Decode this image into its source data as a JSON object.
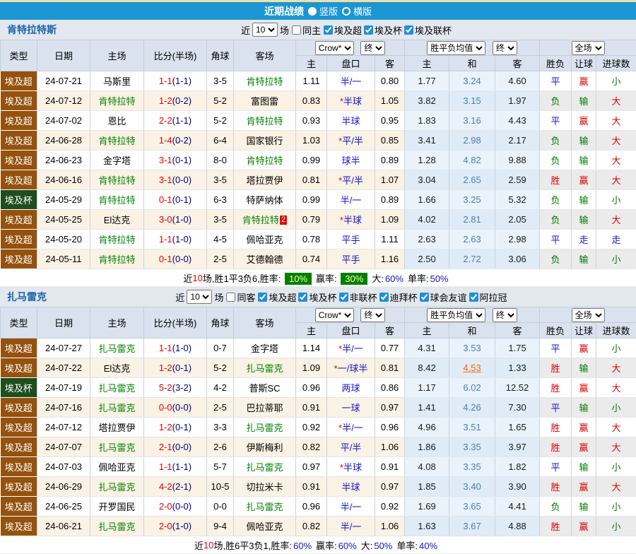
{
  "topbar": {
    "title": "近期战绩",
    "radio_vertical": "竖版",
    "radio_horizontal": "横版"
  },
  "colors": {
    "topbar_bg": "#1B96D2",
    "league_type_bg": "#94520E",
    "cup_type_bg": "#1E4D1E",
    "focus_team": "#008000",
    "win_red": "#DD0000",
    "draw_blue": "#1414CC",
    "loss_green": "#007A00",
    "badge_green_bg": "#008000",
    "link_orange": "#FF6600",
    "fulltime_score": "#E60000",
    "halftime_score": "#000080"
  },
  "filters_common": {
    "near": "近",
    "count": "10",
    "games": "场"
  },
  "dropdowns": {
    "company": "Crow*",
    "final": "终",
    "avg": "胜平负均值",
    "scope": "全场"
  },
  "columns": {
    "type": "类型",
    "date": "日期",
    "home": "主场",
    "score": "比分(半场)",
    "corner": "角球",
    "away": "客场",
    "odds_home": "主",
    "handicap": "盘口",
    "odds_away": "客",
    "avg_home": "主",
    "avg_draw": "和",
    "avg_away": "客",
    "result_wdl": "胜负",
    "result_handicap": "让球",
    "result_goals": "进球数"
  },
  "sections": [
    {
      "team": "肯特拉特斯",
      "filters": {
        "same_label": "同主",
        "same_checked": false,
        "leagues": [
          {
            "label": "埃及超",
            "checked": true
          },
          {
            "label": "埃及杯",
            "checked": true
          },
          {
            "label": "埃及联杯",
            "checked": true
          }
        ]
      },
      "rows": [
        {
          "type": "埃及超",
          "cup": false,
          "date": "24-07-21",
          "home": "马斯里",
          "home_focus": false,
          "score": "1-1",
          "half": "(1-1)",
          "corner": "3-5",
          "away": "肯特拉特",
          "away_focus": true,
          "away_badge": "",
          "o1": "1.11",
          "star": "",
          "hcp": "半/一",
          "o2": "0.80",
          "a1": "1.77",
          "a2": "3.24",
          "a2_link": false,
          "a3": "4.60",
          "r1": "平",
          "r1c": "blue",
          "r2": "赢",
          "r2c": "red",
          "r3": "小",
          "r3c": "green"
        },
        {
          "type": "埃及超",
          "cup": false,
          "date": "24-07-12",
          "home": "肯特拉特",
          "home_focus": true,
          "score": "1-2",
          "half": "(0-2)",
          "corner": "5-2",
          "away": "富图雷",
          "away_focus": false,
          "away_badge": "",
          "o1": "0.83",
          "star": "*",
          "hcp": "半球",
          "o2": "1.05",
          "a1": "3.82",
          "a2": "3.15",
          "a2_link": false,
          "a3": "1.97",
          "r1": "负",
          "r1c": "green",
          "r2": "输",
          "r2c": "green",
          "r3": "大",
          "r3c": "red"
        },
        {
          "type": "埃及超",
          "cup": false,
          "date": "24-07-02",
          "home": "恩比",
          "home_focus": false,
          "score": "2-2",
          "half": "(1-1)",
          "corner": "5-2",
          "away": "肯特拉特",
          "away_focus": true,
          "away_badge": "",
          "o1": "0.93",
          "star": "",
          "hcp": "半球",
          "o2": "0.95",
          "a1": "1.83",
          "a2": "3.16",
          "a2_link": false,
          "a3": "4.43",
          "r1": "平",
          "r1c": "blue",
          "r2": "赢",
          "r2c": "red",
          "r3": "大",
          "r3c": "red"
        },
        {
          "type": "埃及超",
          "cup": false,
          "date": "24-06-28",
          "home": "肯特拉特",
          "home_focus": true,
          "score": "1-4",
          "half": "(0-2)",
          "corner": "6-4",
          "away": "国家银行",
          "away_focus": false,
          "away_badge": "",
          "o1": "1.03",
          "star": "*",
          "hcp": "平/半",
          "o2": "0.85",
          "a1": "3.41",
          "a2": "2.98",
          "a2_link": false,
          "a3": "2.17",
          "r1": "负",
          "r1c": "green",
          "r2": "输",
          "r2c": "green",
          "r3": "大",
          "r3c": "red"
        },
        {
          "type": "埃及超",
          "cup": false,
          "date": "24-06-23",
          "home": "金字塔",
          "home_focus": false,
          "score": "3-1",
          "half": "(0-1)",
          "corner": "8-0",
          "away": "肯特拉特",
          "away_focus": true,
          "away_badge": "",
          "o1": "0.99",
          "star": "",
          "hcp": "球半",
          "o2": "0.89",
          "a1": "1.28",
          "a2": "4.82",
          "a2_link": false,
          "a3": "9.88",
          "r1": "负",
          "r1c": "green",
          "r2": "输",
          "r2c": "green",
          "r3": "大",
          "r3c": "red"
        },
        {
          "type": "埃及超",
          "cup": false,
          "date": "24-06-16",
          "home": "肯特拉特",
          "home_focus": true,
          "score": "3-1",
          "half": "(0-0)",
          "corner": "3-5",
          "away": "塔拉贾伊",
          "away_focus": false,
          "away_badge": "",
          "o1": "0.81",
          "star": "*",
          "hcp": "平/半",
          "o2": "1.07",
          "a1": "3.04",
          "a2": "2.65",
          "a2_link": false,
          "a3": "2.59",
          "r1": "胜",
          "r1c": "red",
          "r2": "赢",
          "r2c": "red",
          "r3": "大",
          "r3c": "red"
        },
        {
          "type": "埃及杯",
          "cup": true,
          "date": "24-05-29",
          "home": "肯特拉特",
          "home_focus": true,
          "score": "0-1",
          "half": "(0-1)",
          "corner": "6-3",
          "away": "特萨纳体",
          "away_focus": false,
          "away_badge": "",
          "o1": "0.99",
          "star": "",
          "hcp": "半/一",
          "o2": "0.89",
          "a1": "1.66",
          "a2": "3.25",
          "a2_link": false,
          "a3": "5.32",
          "r1": "负",
          "r1c": "green",
          "r2": "输",
          "r2c": "green",
          "r3": "小",
          "r3c": "green"
        },
        {
          "type": "埃及超",
          "cup": false,
          "date": "24-05-25",
          "home": "El达克",
          "home_focus": false,
          "score": "3-0",
          "half": "(1-0)",
          "corner": "3-5",
          "away": "肯特拉特",
          "away_focus": true,
          "away_badge": "2",
          "o1": "0.79",
          "star": "*",
          "hcp": "半球",
          "o2": "1.09",
          "a1": "4.02",
          "a2": "2.81",
          "a2_link": false,
          "a3": "2.05",
          "r1": "负",
          "r1c": "green",
          "r2": "输",
          "r2c": "green",
          "r3": "大",
          "r3c": "red"
        },
        {
          "type": "埃及超",
          "cup": false,
          "date": "24-05-20",
          "home": "肯特拉特",
          "home_focus": true,
          "score": "1-1",
          "half": "(1-0)",
          "corner": "4-5",
          "away": "佩哈亚克",
          "away_focus": false,
          "away_badge": "",
          "o1": "0.78",
          "star": "",
          "hcp": "平手",
          "o2": "1.11",
          "a1": "2.63",
          "a2": "2.63",
          "a2_link": false,
          "a3": "2.98",
          "r1": "平",
          "r1c": "blue",
          "r2": "走",
          "r2c": "blue",
          "r3": "走",
          "r3c": "blue"
        },
        {
          "type": "埃及超",
          "cup": false,
          "date": "24-05-11",
          "home": "肯特拉特",
          "home_focus": true,
          "score": "0-1",
          "half": "(0-0)",
          "corner": "2-5",
          "away": "艾德翰德",
          "away_focus": false,
          "away_badge": "",
          "o1": "0.74",
          "star": "",
          "hcp": "平手",
          "o2": "1.16",
          "a1": "2.50",
          "a2": "2.72",
          "a2_link": false,
          "a3": "3.06",
          "r1": "负",
          "r1c": "green",
          "r2": "输",
          "r2c": "green",
          "r3": "小",
          "r3c": "green"
        }
      ],
      "summary": {
        "count": "10",
        "record": "场,胜1平3负6, ",
        "items": [
          {
            "label": "胜率: ",
            "value": "10%",
            "badge": true
          },
          {
            "label": "赢率: ",
            "value": "30%",
            "badge": true
          },
          {
            "label": "大:",
            "value": "60%",
            "badge": false
          },
          {
            "label": "单率:",
            "value": "50%",
            "badge": false
          }
        ]
      }
    },
    {
      "team": "扎马雷克",
      "filters": {
        "same_label": "同客",
        "same_checked": false,
        "leagues": [
          {
            "label": "埃及超",
            "checked": true
          },
          {
            "label": "埃及杯",
            "checked": true
          },
          {
            "label": "非联杯",
            "checked": true
          },
          {
            "label": "迪拜杯",
            "checked": true
          },
          {
            "label": "球会友谊",
            "checked": true
          },
          {
            "label": "阿拉冠",
            "checked": true
          }
        ]
      },
      "rows": [
        {
          "type": "埃及超",
          "cup": false,
          "date": "24-07-27",
          "home": "扎马雷克",
          "home_focus": true,
          "score": "1-1",
          "half": "(1-0)",
          "corner": "0-7",
          "away": "金字塔",
          "away_focus": false,
          "away_badge": "",
          "o1": "1.14",
          "star": "*",
          "hcp": "半/一",
          "o2": "0.77",
          "a1": "4.31",
          "a2": "3.53",
          "a2_link": false,
          "a3": "1.75",
          "r1": "平",
          "r1c": "blue",
          "r2": "赢",
          "r2c": "red",
          "r3": "小",
          "r3c": "green"
        },
        {
          "type": "埃及超",
          "cup": false,
          "date": "24-07-22",
          "home": "El达克",
          "home_focus": false,
          "score": "1-2",
          "half": "(0-1)",
          "corner": "5-2",
          "away": "扎马雷克",
          "away_focus": true,
          "away_badge": "",
          "o1": "1.09",
          "star": "*",
          "hcp": "一/球半",
          "o2": "0.81",
          "a1": "8.42",
          "a2": "4.53",
          "a2_link": true,
          "a3": "1.33",
          "r1": "胜",
          "r1c": "red",
          "r2": "输",
          "r2c": "green",
          "r3": "大",
          "r3c": "red"
        },
        {
          "type": "埃及杯",
          "cup": true,
          "date": "24-07-19",
          "home": "扎马雷克",
          "home_focus": true,
          "score": "5-2",
          "half": "(3-2)",
          "corner": "4-2",
          "away": "普斯SC",
          "away_focus": false,
          "away_badge": "",
          "o1": "0.96",
          "star": "",
          "hcp": "两球",
          "o2": "0.86",
          "a1": "1.17",
          "a2": "6.02",
          "a2_link": false,
          "a3": "12.52",
          "r1": "胜",
          "r1c": "red",
          "r2": "赢",
          "r2c": "red",
          "r3": "大",
          "r3c": "red"
        },
        {
          "type": "埃及超",
          "cup": false,
          "date": "24-07-16",
          "home": "扎马雷克",
          "home_focus": true,
          "score": "0-0",
          "half": "(0-0)",
          "corner": "2-5",
          "away": "巴拉蒂耶",
          "away_focus": false,
          "away_badge": "",
          "o1": "0.91",
          "star": "",
          "hcp": "一球",
          "o2": "0.97",
          "a1": "1.41",
          "a2": "4.26",
          "a2_link": false,
          "a3": "7.30",
          "r1": "平",
          "r1c": "blue",
          "r2": "输",
          "r2c": "green",
          "r3": "小",
          "r3c": "green"
        },
        {
          "type": "埃及超",
          "cup": false,
          "date": "24-07-12",
          "home": "塔拉贾伊",
          "home_focus": false,
          "score": "1-2",
          "half": "(0-1)",
          "corner": "3-3",
          "away": "扎马雷克",
          "away_focus": true,
          "away_badge": "",
          "o1": "0.92",
          "star": "*",
          "hcp": "半/一",
          "o2": "0.96",
          "a1": "4.96",
          "a2": "3.51",
          "a2_link": false,
          "a3": "1.65",
          "r1": "胜",
          "r1c": "red",
          "r2": "赢",
          "r2c": "red",
          "r3": "大",
          "r3c": "red"
        },
        {
          "type": "埃及超",
          "cup": false,
          "date": "24-07-07",
          "home": "扎马雷克",
          "home_focus": true,
          "score": "2-1",
          "half": "(0-0)",
          "corner": "2-6",
          "away": "伊斯梅利",
          "away_focus": false,
          "away_badge": "",
          "o1": "0.82",
          "star": "",
          "hcp": "平/半",
          "o2": "1.06",
          "a1": "1.86",
          "a2": "3.35",
          "a2_link": false,
          "a3": "3.97",
          "r1": "胜",
          "r1c": "red",
          "r2": "赢",
          "r2c": "red",
          "r3": "大",
          "r3c": "red"
        },
        {
          "type": "埃及超",
          "cup": false,
          "date": "24-07-03",
          "home": "佩哈亚克",
          "home_focus": false,
          "score": "1-1",
          "half": "(1-1)",
          "corner": "5-7",
          "away": "扎马雷克",
          "away_focus": true,
          "away_badge": "",
          "o1": "0.97",
          "star": "*",
          "hcp": "半球",
          "o2": "0.91",
          "a1": "4.08",
          "a2": "3.35",
          "a2_link": false,
          "a3": "1.82",
          "r1": "平",
          "r1c": "blue",
          "r2": "输",
          "r2c": "green",
          "r3": "小",
          "r3c": "green"
        },
        {
          "type": "埃及超",
          "cup": false,
          "date": "24-06-29",
          "home": "扎马雷克",
          "home_focus": true,
          "score": "4-2",
          "half": "(2-1)",
          "corner": "10-5",
          "away": "切拉米卡",
          "away_focus": false,
          "away_badge": "",
          "o1": "0.91",
          "star": "",
          "hcp": "半球",
          "o2": "0.97",
          "a1": "1.85",
          "a2": "3.40",
          "a2_link": false,
          "a3": "3.90",
          "r1": "胜",
          "r1c": "red",
          "r2": "赢",
          "r2c": "red",
          "r3": "大",
          "r3c": "red"
        },
        {
          "type": "埃及超",
          "cup": false,
          "date": "24-06-25",
          "home": "开罗国民",
          "home_focus": false,
          "score": "2-0",
          "half": "(0-0)",
          "corner": "0-0",
          "away": "扎马雷克",
          "away_focus": true,
          "away_badge": "",
          "o1": "0.96",
          "star": "",
          "hcp": "半/一",
          "o2": "0.92",
          "a1": "1.69",
          "a2": "3.65",
          "a2_link": false,
          "a3": "4.41",
          "r1": "负",
          "r1c": "green",
          "r2": "输",
          "r2c": "green",
          "r3": "小",
          "r3c": "green"
        },
        {
          "type": "埃及超",
          "cup": false,
          "date": "24-06-21",
          "home": "扎马雷克",
          "home_focus": true,
          "score": "2-0",
          "half": "(1-0)",
          "corner": "9-4",
          "away": "佩哈亚克",
          "away_focus": false,
          "away_badge": "",
          "o1": "0.82",
          "star": "",
          "hcp": "半/一",
          "o2": "1.06",
          "a1": "1.63",
          "a2": "3.67",
          "a2_link": false,
          "a3": "4.88",
          "r1": "胜",
          "r1c": "red",
          "r2": "赢",
          "r2c": "red",
          "r3": "小",
          "r3c": "green"
        }
      ],
      "summary": {
        "count": "10",
        "record": "场,胜6平3负1, ",
        "items": [
          {
            "label": "胜率:",
            "value": "60%",
            "badge": false
          },
          {
            "label": "赢率:",
            "value": "60%",
            "badge": false
          },
          {
            "label": "大:",
            "value": "50%",
            "badge": false
          },
          {
            "label": "单率:",
            "value": "40%",
            "badge": false
          }
        ]
      }
    }
  ]
}
